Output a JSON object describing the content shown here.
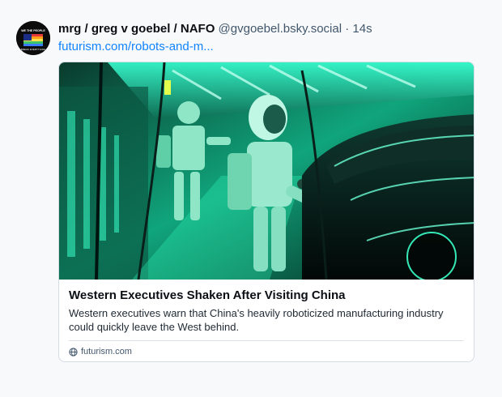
{
  "author": {
    "display_name": "mrg / greg v goebel / NAFO",
    "handle": "@gvgoebel.bsky.social",
    "separator": "·",
    "time": "14s",
    "avatar_text_top": "WE THE PEOPLE",
    "avatar_text_bottom": "BREAK EVERYTHING"
  },
  "post": {
    "link_text": "futurism.com/robots-and-m..."
  },
  "card": {
    "title": "Western Executives Shaken After Visiting China",
    "description": "Western executives warn that China's heavily roboticized manufacturing industry could quickly leave the West behind.",
    "domain": "futurism.com"
  },
  "icons": {
    "globe": "globe-icon"
  },
  "colors": {
    "link": "#1083fe",
    "image_tint": "#14e3a6"
  }
}
